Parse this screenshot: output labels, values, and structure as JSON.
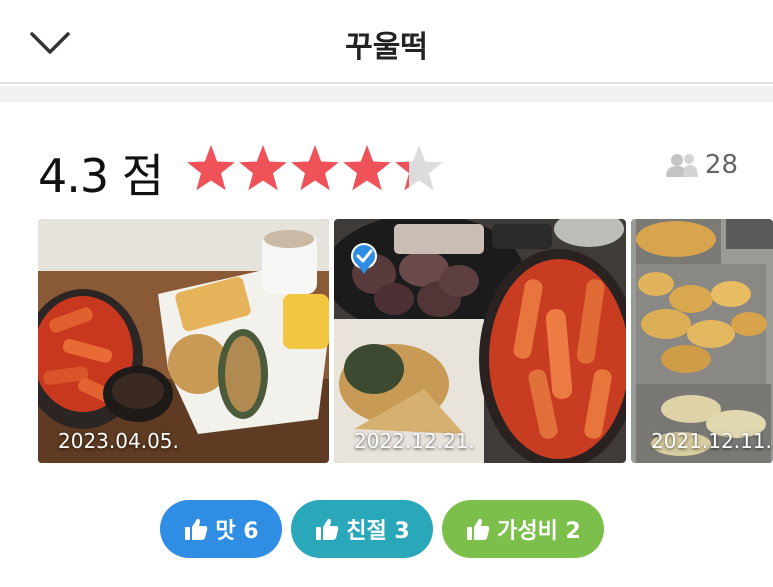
{
  "header": {
    "title": "꾸울떡",
    "back_icon": "chevron-down-icon"
  },
  "rating": {
    "score_text": "4.3 점",
    "score": 4.3,
    "max": 5,
    "star_color": "#f0525a",
    "empty_color": "#dcdcdc"
  },
  "review_count": {
    "icon": "people-icon",
    "value": "28"
  },
  "photos": [
    {
      "date": "2023.04.05."
    },
    {
      "date": "2022.12.21.",
      "badge_icon": "verified-check-icon"
    },
    {
      "date": "2021.12.11."
    }
  ],
  "tags": [
    {
      "icon": "thumbs-up-icon",
      "label": "맛 6",
      "color": "#2f8de4"
    },
    {
      "icon": "thumbs-up-icon",
      "label": "친절 3",
      "color": "#2aa7b9"
    },
    {
      "icon": "thumbs-up-icon",
      "label": "가성비 2",
      "color": "#7cc04b"
    }
  ]
}
